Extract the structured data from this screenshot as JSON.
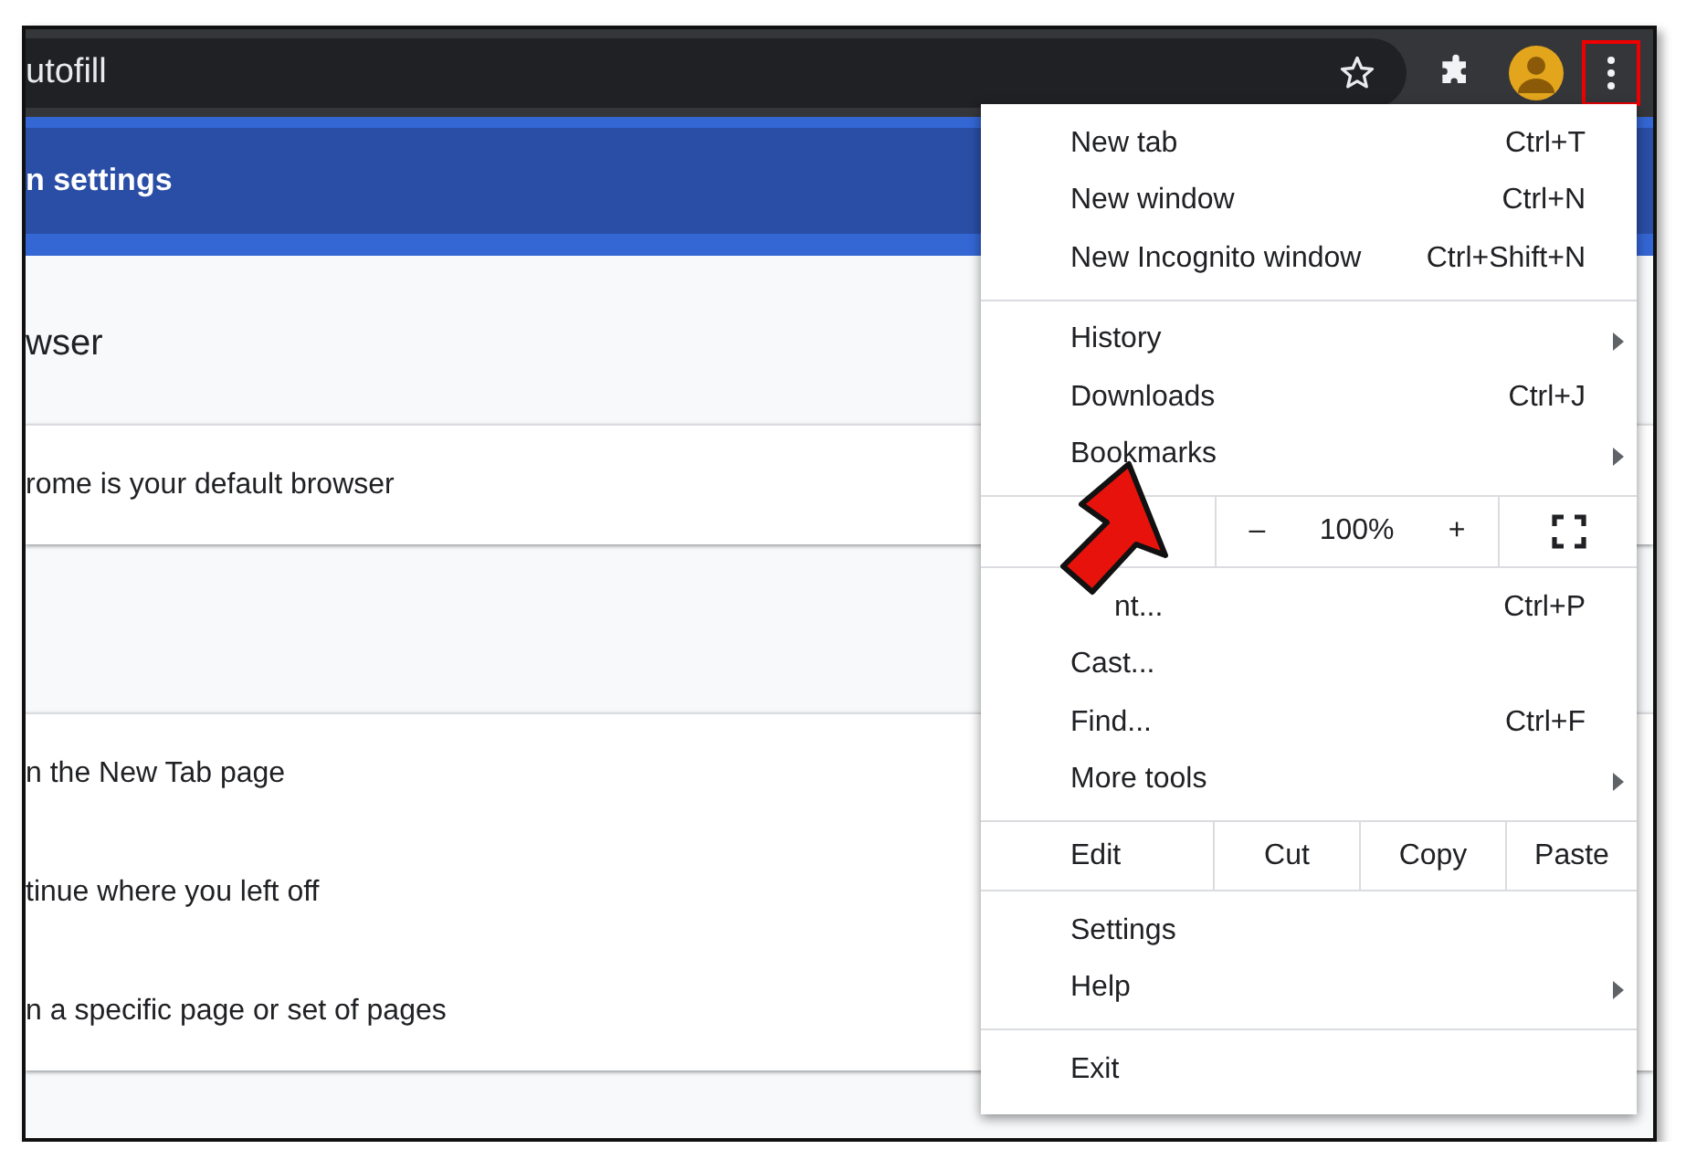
{
  "toolbar": {
    "address": "utofill"
  },
  "banner": {
    "title": "n settings"
  },
  "sections": [
    {
      "heading": "wser",
      "rows": [
        "rome is your default browser"
      ]
    },
    {
      "rows": [
        "n the New Tab page",
        "tinue where you left off",
        "n a specific page or set of pages"
      ]
    }
  ],
  "menu": {
    "sections": [
      {
        "items": [
          {
            "kind": "item",
            "label": "New tab",
            "shortcut": "Ctrl+T"
          },
          {
            "kind": "item",
            "label": "New window",
            "shortcut": "Ctrl+N"
          },
          {
            "kind": "item",
            "label": "New Incognito window",
            "shortcut": "Ctrl+Shift+N"
          }
        ]
      },
      {
        "items": [
          {
            "kind": "submenu",
            "label": "History"
          },
          {
            "kind": "item",
            "label": "Downloads",
            "shortcut": "Ctrl+J"
          },
          {
            "kind": "submenu",
            "label": "Bookmarks"
          }
        ]
      },
      {
        "items": [
          {
            "kind": "zoom",
            "minus": "–",
            "value": "100%",
            "plus": "+"
          }
        ]
      },
      {
        "items": [
          {
            "kind": "item",
            "label": "nt...",
            "shortcut": "Ctrl+P"
          },
          {
            "kind": "item",
            "label": "Cast..."
          },
          {
            "kind": "item",
            "label": "Find...",
            "shortcut": "Ctrl+F"
          },
          {
            "kind": "submenu",
            "label": "More tools"
          }
        ]
      },
      {
        "items": [
          {
            "kind": "edit",
            "label": "Edit",
            "buttons": [
              "Cut",
              "Copy",
              "Paste"
            ]
          }
        ]
      },
      {
        "items": [
          {
            "kind": "item",
            "label": "Settings"
          },
          {
            "kind": "submenu",
            "label": "Help"
          }
        ]
      },
      {
        "items": [
          {
            "kind": "item",
            "label": "Exit"
          }
        ]
      }
    ]
  }
}
